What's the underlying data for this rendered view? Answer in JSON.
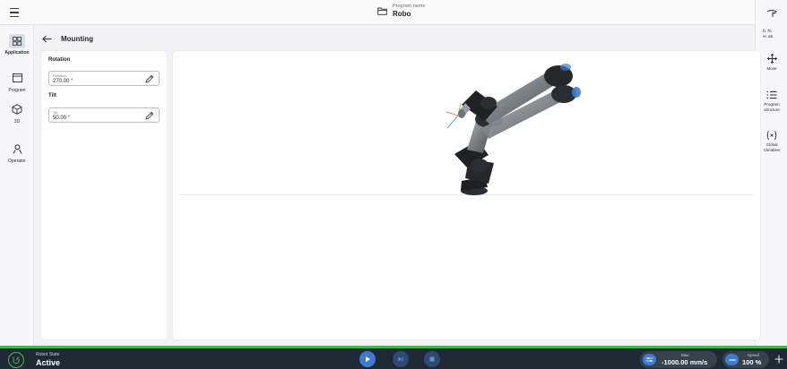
{
  "topbar": {
    "menu_icon": "hamburger-menu-icon",
    "program_label": "Program name",
    "program_name": "Robo",
    "folder_icon": "folder-icon"
  },
  "leftnav": {
    "items": [
      {
        "label": "Application",
        "icon": "grid-icon",
        "active": true
      },
      {
        "label": "Program",
        "icon": "window-icon",
        "active": false
      },
      {
        "label": "3D",
        "icon": "cube-icon",
        "active": false
      },
      {
        "label": "Operator",
        "icon": "person-icon",
        "active": false
      }
    ]
  },
  "rightrail": {
    "top_icon": "robot-gripper-icon",
    "coords_line1": "fx 76",
    "coords_line2": "ec a5",
    "items": [
      {
        "label": "Move",
        "icon": "move-arrows-icon"
      },
      {
        "label_line1": "Program",
        "label_line2": "structure",
        "icon": "list-icon"
      },
      {
        "label_line1": "Global",
        "label_line2": "Variables",
        "icon": "variables-icon"
      }
    ]
  },
  "header": {
    "title": "Mounting"
  },
  "panel": {
    "rotation_heading": "Rotation",
    "rotation_field_label": "Rotation",
    "rotation_value": "270.00 °",
    "tilt_heading": "Tilt",
    "tilt_field_label": "Tilt",
    "tilt_value": "50.00 °"
  },
  "bottombar": {
    "robot_state_label": "Robot State",
    "robot_state": "Active",
    "max_label": "Max",
    "max_value": "-1000.00 mm/s",
    "speed_label": "Speed",
    "speed_value": "100 %"
  },
  "colors": {
    "accent_green": "#3fb950",
    "accent_blue": "#3b7bd6",
    "bottom_bar": "#1f2933"
  }
}
